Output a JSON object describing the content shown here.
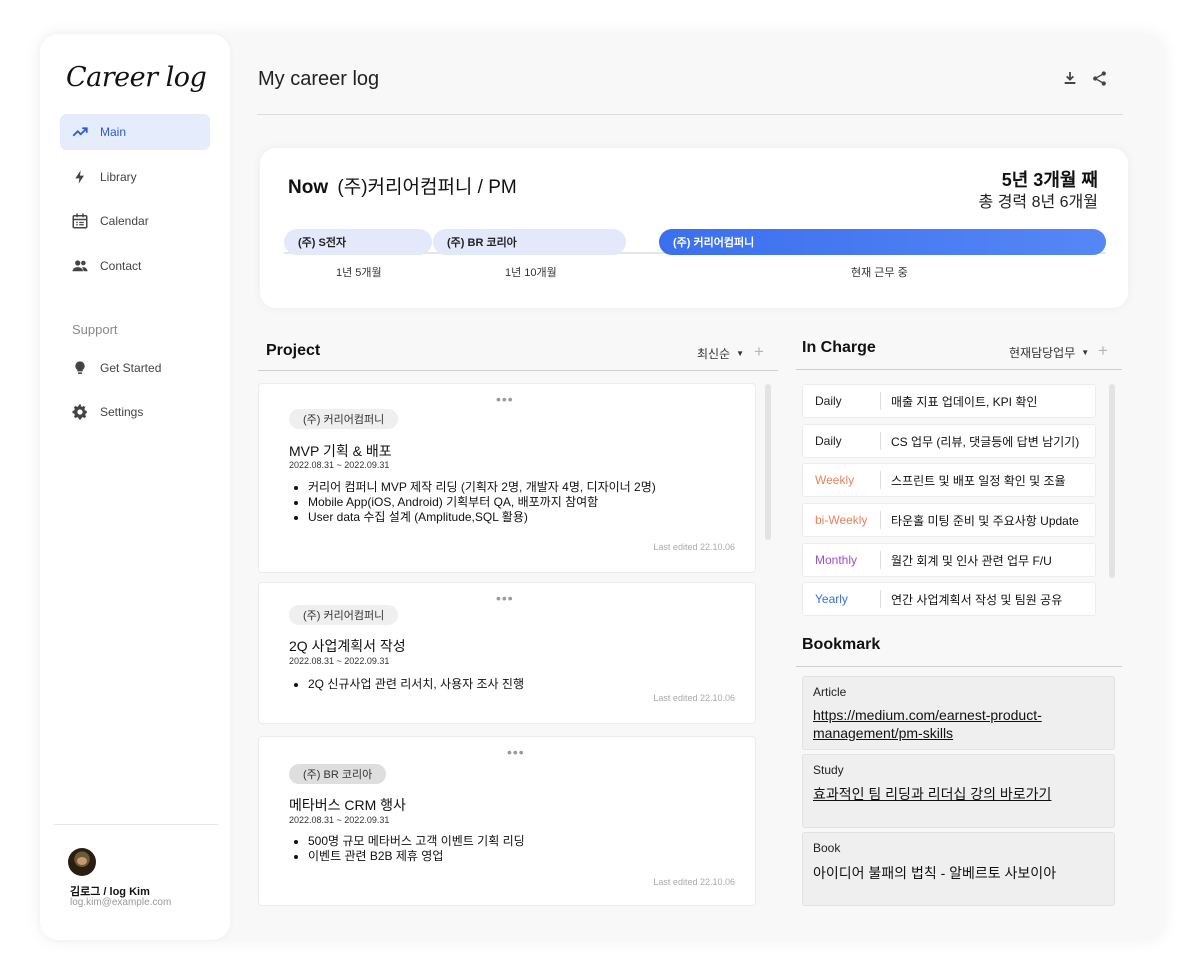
{
  "sidebar": {
    "logo": "Career log",
    "nav": [
      {
        "label": "Main",
        "icon": "trending-up-icon"
      },
      {
        "label": "Library",
        "icon": "bolt-icon"
      },
      {
        "label": "Calendar",
        "icon": "calendar-icon"
      },
      {
        "label": "Contact",
        "icon": "people-icon"
      }
    ],
    "support_label": "Support",
    "support": [
      {
        "label": "Get Started",
        "icon": "lightbulb-icon"
      },
      {
        "label": "Settings",
        "icon": "gear-icon"
      }
    ],
    "user": {
      "name": "김로그 / log Kim",
      "email": "log.kim@example.com"
    }
  },
  "header": {
    "title": "My career log",
    "download_icon": "download-icon",
    "share_icon": "share-icon"
  },
  "now": {
    "prefix": "Now",
    "company_role": "(주)커리어컴퍼니 / PM",
    "tenure": "5년 3개월 째",
    "total": "총 경력 8년 6개월",
    "timeline": [
      {
        "company": "(주) S전자",
        "duration": "1년 5개월"
      },
      {
        "company": "(주) BR 코리아",
        "duration": "1년 10개월"
      },
      {
        "company": "(주) 커리어컴퍼니",
        "duration": "현재 근무 중"
      }
    ]
  },
  "project": {
    "title": "Project",
    "sort": "최신순",
    "cards": [
      {
        "tag": "(주) 커리어컴퍼니",
        "title": "MVP 기획 & 배포",
        "date": "2022.08.31 ~ 2022.09.31",
        "bullets": [
          "커리어 컴퍼니 MVP 제작 리딩 (기획자 2명, 개발자 4명, 디자이너 2명)",
          "Mobile App(iOS, Android) 기획부터 QA, 배포까지 참여함",
          "User data 수집 설계 (Amplitude,SQL 활용)"
        ],
        "edited": "Last edited 22.10.06"
      },
      {
        "tag": "(주) 커리어컴퍼니",
        "title": "2Q 사업계획서 작성",
        "date": "2022.08.31 ~ 2022.09.31",
        "bullets": [
          "2Q 신규사업 관련 리서치, 사용자 조사 진행"
        ],
        "edited": "Last edited 22.10.06"
      },
      {
        "tag": "(주) BR 코리아",
        "title": "메타버스 CRM 행사",
        "date": "2022.08.31 ~ 2022.09.31",
        "bullets": [
          "500명 규모 메타버스 고객 이벤트 기획 리딩",
          "이벤트 관련 B2B 제휴 영업"
        ],
        "edited": "Last edited 22.10.06"
      }
    ]
  },
  "in_charge": {
    "title": "In Charge",
    "sort": "현재담당업무",
    "items": [
      {
        "freq": "Daily",
        "task": "매출 지표 업데이트, KPI 확인",
        "color": "#222222"
      },
      {
        "freq": "Daily",
        "task": "CS 업무 (리뷰, 댓글등에 답변 남기기)",
        "color": "#222222"
      },
      {
        "freq": "Weekly",
        "task": "스프린트 및 배포 일정 확인 및 조율",
        "color": "#e8825f"
      },
      {
        "freq": "bi-Weekly",
        "task": "타운홀 미팅 준비 및 주요사항 Update",
        "color": "#e8825f"
      },
      {
        "freq": "Monthly",
        "task": "월간 회계 및 인사 관련 업무 F/U",
        "color": "#9b4fc9"
      },
      {
        "freq": "Yearly",
        "task": "연간 사업계획서 작성 및 팀원 공유",
        "color": "#3a6fd6"
      }
    ]
  },
  "bookmark": {
    "title": "Bookmark",
    "items": [
      {
        "type": "Article",
        "line1": "https://medium.com/earnest-product-",
        "line2": "management/pm-skills"
      },
      {
        "type": "Study",
        "text": "효과적인 팀 리딩과 리더십 강의 바로가기"
      },
      {
        "type": "Book",
        "text": "아이디어 불패의 법칙 - 알베르토 사보이아"
      }
    ]
  }
}
